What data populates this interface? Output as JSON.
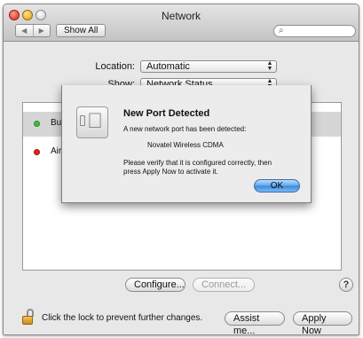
{
  "window": {
    "title": "Network"
  },
  "toolbar": {
    "back_glyph": "◀",
    "forward_glyph": "▶",
    "show_all_label": "Show All",
    "search_icon_glyph": "⌕",
    "search_value": ""
  },
  "location": {
    "label": "Location:",
    "value": "Automatic"
  },
  "show": {
    "label": "Show:",
    "value": "Network Status"
  },
  "services": [
    {
      "label": "Bui",
      "status_color": "#3fbd3a",
      "selected": true
    },
    {
      "label": "Airl",
      "status_color": "#e0241b",
      "selected": false
    }
  ],
  "buttons": {
    "configure_label": "Configure...",
    "connect_label": "Connect...",
    "help_label": "?",
    "assist_label": "Assist me...",
    "apply_label": "Apply Now"
  },
  "lock": {
    "text": "Click the lock to prevent further changes."
  },
  "dialog": {
    "title": "New Port Detected",
    "message": "A new network port has been detected:",
    "port_name": "Novatel Wireless CDMA",
    "instruction_line1": "Please verify that it is configured correctly, then",
    "instruction_line2": "press Apply Now to activate it.",
    "ok_label": "OK",
    "icon_glyph": ""
  },
  "colors": {
    "ok_button": "#5ea6ee",
    "status_ok": "#3fbd3a",
    "status_off": "#e0241b"
  }
}
